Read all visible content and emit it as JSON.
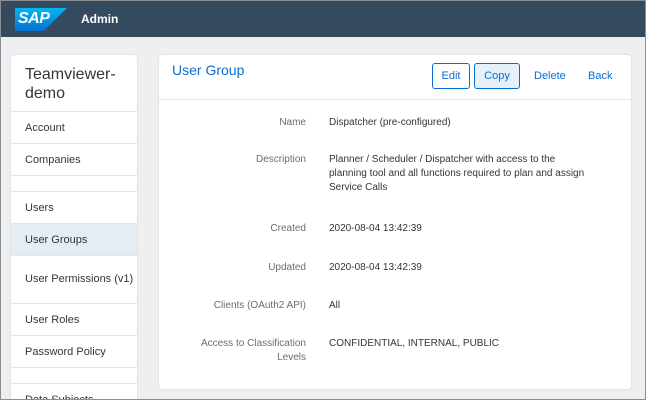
{
  "shell": {
    "logo_text": "SAP",
    "title": "Admin",
    "bar_color": "#354a5f",
    "logo_color": "#0a6ed1"
  },
  "sidebar": {
    "tenant_name": "Teamviewer-demo",
    "items": [
      {
        "label": "Account"
      },
      {
        "label": "Companies"
      },
      {
        "label": "Users"
      },
      {
        "label": "User Groups",
        "active": true
      },
      {
        "label": "User Permissions (v1)"
      },
      {
        "label": "User Roles"
      },
      {
        "label": "Password Policy"
      },
      {
        "label": "Data Subjects"
      }
    ]
  },
  "main": {
    "title": "User Group",
    "buttons": {
      "edit": "Edit",
      "copy": "Copy",
      "delete": "Delete",
      "back": "Back"
    },
    "fields": [
      {
        "label": "Name",
        "value": "Dispatcher (pre-configured)"
      },
      {
        "label": "Description",
        "value": "Planner / Scheduler / Dispatcher with access to the planning tool and all functions required to plan and assign Service Calls"
      },
      {
        "label": "Created",
        "value": "2020-08-04 13:42:39"
      },
      {
        "label": "Updated",
        "value": "2020-08-04 13:42:39"
      },
      {
        "label": "Clients (OAuth2 API)",
        "value": "All"
      },
      {
        "label": "Access to Classification Levels",
        "value": "CONFIDENTIAL, INTERNAL, PUBLIC"
      }
    ]
  }
}
